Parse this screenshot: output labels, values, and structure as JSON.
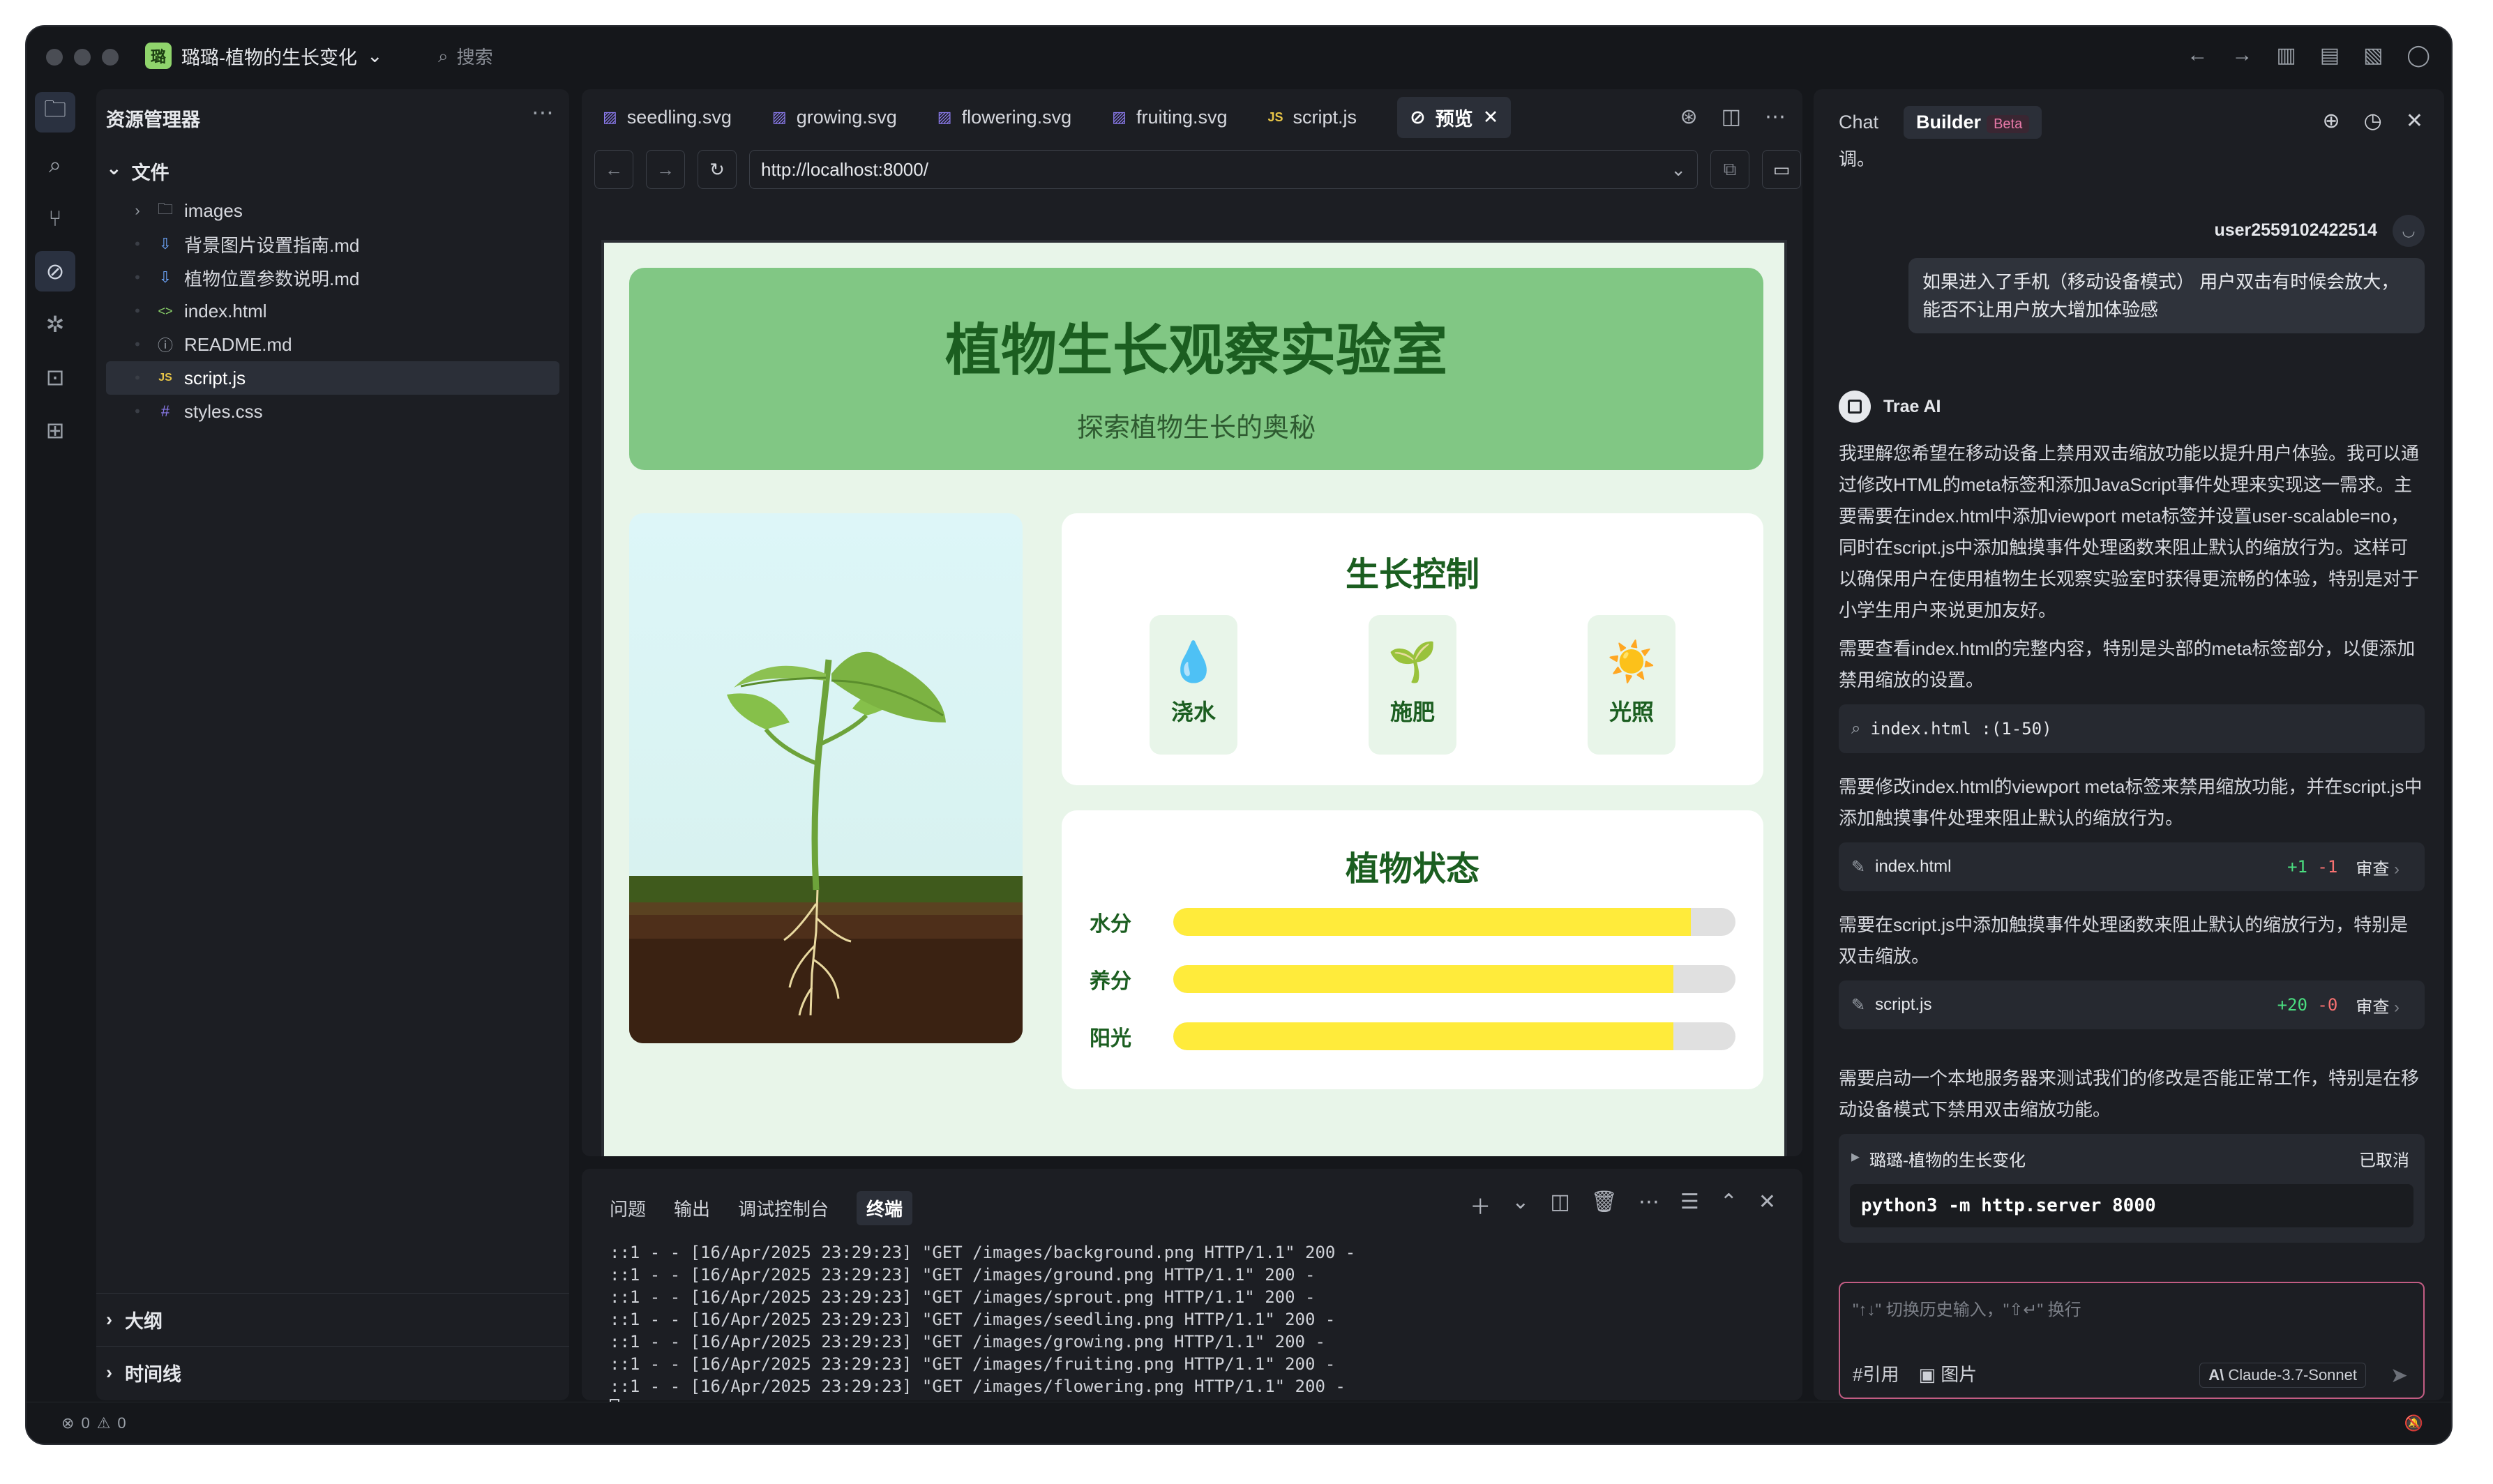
{
  "titlebar": {
    "project_badge": "璐",
    "project": "璐璐-植物的生长变化",
    "search": "搜索"
  },
  "explorer": {
    "title": "资源管理器",
    "folder": "文件",
    "items": [
      {
        "name": "images",
        "icon": "folder-icon"
      },
      {
        "name": "背景图片设置指南.md",
        "icon": "markdown-icon"
      },
      {
        "name": "植物位置参数说明.md",
        "icon": "markdown-icon"
      },
      {
        "name": "index.html",
        "icon": "html-icon"
      },
      {
        "name": "README.md",
        "icon": "info-icon"
      },
      {
        "name": "script.js",
        "icon": "js-icon"
      },
      {
        "name": "styles.css",
        "icon": "css-icon"
      }
    ],
    "outline": "大纲",
    "timeline": "时间线"
  },
  "editor": {
    "tabs": [
      "seedling.svg",
      "growing.svg",
      "flowering.svg",
      "fruiting.svg",
      "script.js",
      "预览"
    ],
    "url": "http://localhost:8000/"
  },
  "preview": {
    "title": "植物生长观察实验室",
    "subtitle": "探索植物生长的奥秘",
    "controls_title": "生长控制",
    "controls": [
      {
        "label": "浇水",
        "icon": "water-drop-icon",
        "glyph": "💧"
      },
      {
        "label": "施肥",
        "icon": "sprout-icon",
        "glyph": "🌱"
      },
      {
        "label": "光照",
        "icon": "sun-icon",
        "glyph": "☀️"
      }
    ],
    "status_title": "植物状态",
    "status": [
      {
        "label": "水分",
        "fraction": 0.92
      },
      {
        "label": "养分",
        "fraction": 0.89
      },
      {
        "label": "阳光",
        "fraction": 0.89
      }
    ]
  },
  "panel": {
    "tabs": [
      "问题",
      "输出",
      "调试控制台",
      "终端"
    ],
    "terminal": [
      "::1 - - [16/Apr/2025 23:29:23] \"GET /images/background.png HTTP/1.1\" 200 -",
      "::1 - - [16/Apr/2025 23:29:23] \"GET /images/ground.png HTTP/1.1\" 200 -",
      "::1 - - [16/Apr/2025 23:29:23] \"GET /images/sprout.png HTTP/1.1\" 200 -",
      "::1 - - [16/Apr/2025 23:29:23] \"GET /images/seedling.png HTTP/1.1\" 200 -",
      "::1 - - [16/Apr/2025 23:29:23] \"GET /images/growing.png HTTP/1.1\" 200 -",
      "::1 - - [16/Apr/2025 23:29:23] \"GET /images/fruiting.png HTTP/1.1\" 200 -",
      "::1 - - [16/Apr/2025 23:29:23] \"GET /images/flowering.png HTTP/1.1\" 200 -"
    ]
  },
  "chat": {
    "tab_chat": "Chat",
    "tab_builder": "Builder",
    "beta": "Beta",
    "top_fragment": "调。",
    "user": "user2559102422514",
    "user_message": "如果进入了手机（移动设备模式） 用户双击有时候会放大，能否不让用户放大增加体验感",
    "ai_name": "Trae AI",
    "p1": "我理解您希望在移动设备上禁用双击缩放功能以提升用户体验。我可以通过修改HTML的meta标签和添加JavaScript事件处理来实现这一需求。主要需要在index.html中添加viewport meta标签并设置user-scalable=no，同时在script.js中添加触摸事件处理函数来阻止默认的缩放行为。这样可以确保用户在使用植物生长观察实验室时获得更流畅的体验，特别是对于小学生用户来说更加友好。",
    "p2": "需要查看index.html的完整内容，特别是头部的meta标签部分，以便添加禁用缩放的设置。",
    "ref_card": "index.html :(1-50)",
    "p3": "需要修改index.html的viewport meta标签来禁用缩放功能，并在script.js中添加触摸事件处理来阻止默认的缩放行为。",
    "edit1": {
      "file": "index.html",
      "add": "+1",
      "del": "-1",
      "review": "审查"
    },
    "p4": "需要在script.js中添加触摸事件处理函数来阻止默认的缩放行为，特别是双击缩放。",
    "edit2": {
      "file": "script.js",
      "add": "+20",
      "del": "-0",
      "review": "审查"
    },
    "p5": "需要启动一个本地服务器来测试我们的修改是否能正常工作，特别是在移动设备模式下禁用双击缩放功能。",
    "terminal_card": {
      "title": "璐璐-植物的生长变化",
      "status": "已取消",
      "command": "python3 -m http.server 8000"
    },
    "input_placeholder": "\"↑↓\" 切换历史输入，\"⇧↵\" 换行",
    "cite": "#引用",
    "image": "图片",
    "model": "Claude-3.7-Sonnet"
  },
  "statusbar": {
    "errors": "0",
    "warnings": "0"
  }
}
